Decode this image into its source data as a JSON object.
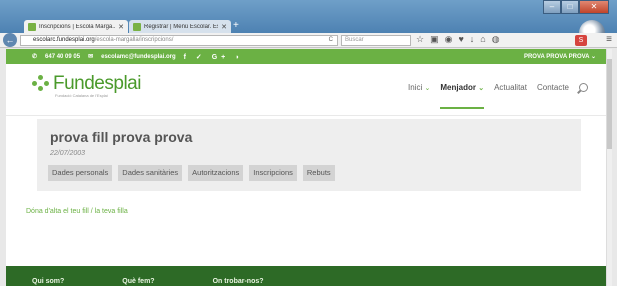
{
  "browser": {
    "tabs": [
      {
        "title": "Inscripcions | Escola Marga..."
      },
      {
        "title": "Registrar | Menú Escolar. Esc..."
      }
    ],
    "url_host": "escolarc.fundesplai.org",
    "url_path": "/escola-margalla/inscripcions/",
    "search_placeholder": "Buscar"
  },
  "topbar": {
    "phone": "647 40 09 05",
    "email": "escolamc@fundesplai.org",
    "social": "f ✓ G+ ◗",
    "user_menu": "PROVA PROVA PROVA ⌄"
  },
  "site": {
    "logo_name": "Fundesplai",
    "logo_subtitle": "Fundació Catalana de l'Esplai"
  },
  "nav": [
    {
      "label": "Inici",
      "arrow": "⌄"
    },
    {
      "label": "Menjador",
      "arrow": "⌄"
    },
    {
      "label": "Actualitat",
      "arrow": ""
    },
    {
      "label": "Contacte",
      "arrow": ""
    }
  ],
  "child": {
    "name": "prova fill prova prova",
    "date": "22/07/2003",
    "tabs": [
      "Dades personals",
      "Dades sanitàries",
      "Autoritzacions",
      "Inscripcions",
      "Rebuts"
    ]
  },
  "add_link": "Dóna d'alta el teu fill / la teva filla",
  "footer": {
    "columns": [
      "Qui som?",
      "Què fem?",
      "On trobar-nos?"
    ]
  }
}
